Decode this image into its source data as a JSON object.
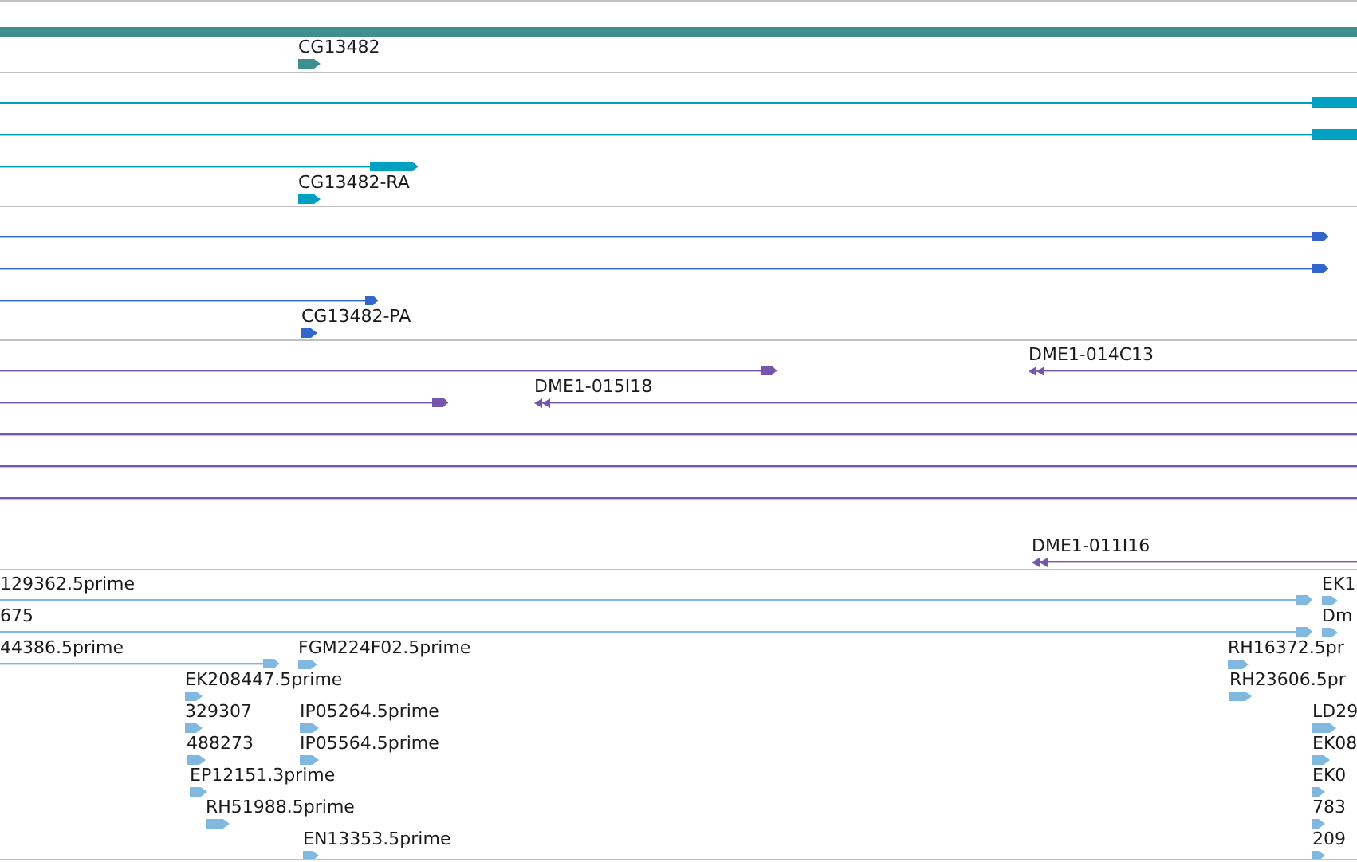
{
  "tracks": [
    {
      "color": "#3f8f8f",
      "features": [
        {
          "kind": "bar"
        },
        {
          "kind": "label",
          "text": "CG13482"
        }
      ]
    },
    {
      "color": "#00a0c0",
      "features": [
        {
          "kind": "exon_line"
        },
        {
          "kind": "exon_line"
        },
        {
          "kind": "arrow_line"
        },
        {
          "kind": "label",
          "text": "CG13482-RA"
        }
      ]
    },
    {
      "color": "#3366cc",
      "features": [
        {
          "kind": "arrow_line"
        },
        {
          "kind": "arrow_line"
        },
        {
          "kind": "arrow_line"
        },
        {
          "kind": "label",
          "text": "CG13482-PA"
        }
      ]
    },
    {
      "color": "#7755aa",
      "features": [
        {
          "kind": "arrow_line"
        },
        {
          "kind": "reverse_label",
          "text": "DME1-014C13"
        },
        {
          "kind": "plain_line"
        },
        {
          "kind": "arrow_line"
        },
        {
          "kind": "reverse_label",
          "text": "DME1-015I18"
        },
        {
          "kind": "plain_line"
        },
        {
          "kind": "plain_line"
        },
        {
          "kind": "plain_line"
        },
        {
          "kind": "plain_line"
        },
        {
          "kind": "reverse_label",
          "text": "DME1-011I16"
        },
        {
          "kind": "plain_line"
        }
      ]
    },
    {
      "color": "#80b8e0",
      "features": [
        {
          "kind": "cut_label",
          "text": "129362.5prime"
        },
        {
          "kind": "arrow_line"
        },
        {
          "kind": "label",
          "text": "EK1"
        },
        {
          "kind": "cut_label",
          "text": "675"
        },
        {
          "kind": "arrow_line"
        },
        {
          "kind": "label",
          "text": "Dm"
        },
        {
          "kind": "cut_label",
          "text": "44386.5prime"
        },
        {
          "kind": "arrow_line"
        },
        {
          "kind": "label",
          "text": "FGM224F02.5prime"
        },
        {
          "kind": "label",
          "text": "RH16372.5pr"
        },
        {
          "kind": "label",
          "text": "EK208447.5prime"
        },
        {
          "kind": "label",
          "text": "RH23606.5pr"
        },
        {
          "kind": "label",
          "text": "329307"
        },
        {
          "kind": "label",
          "text": "IP05264.5prime"
        },
        {
          "kind": "label",
          "text": "LD29"
        },
        {
          "kind": "label",
          "text": "488273"
        },
        {
          "kind": "label",
          "text": "IP05564.5prime"
        },
        {
          "kind": "label",
          "text": "EK08"
        },
        {
          "kind": "label",
          "text": "EP12151.3prime"
        },
        {
          "kind": "label",
          "text": "EK0"
        },
        {
          "kind": "label",
          "text": "RH51988.5prime"
        },
        {
          "kind": "label",
          "text": "783"
        },
        {
          "kind": "label",
          "text": "EN13353.5prime"
        },
        {
          "kind": "label",
          "text": "209"
        }
      ]
    }
  ]
}
